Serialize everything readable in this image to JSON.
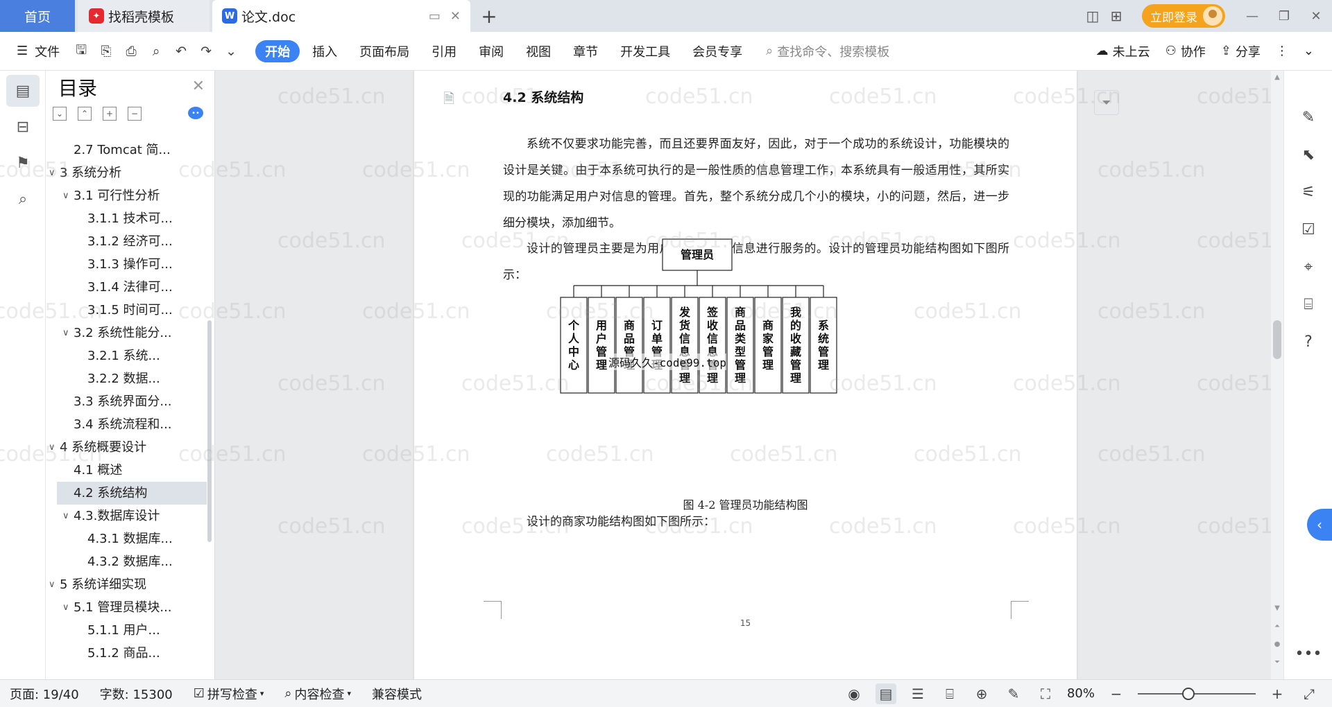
{
  "tabs": {
    "home": "首页",
    "templates": "找稻壳模板",
    "doc": "论文.doc"
  },
  "titlebar": {
    "login": "立即登录"
  },
  "ribbon": {
    "file_menu": "文件",
    "tabs": [
      "开始",
      "插入",
      "页面布局",
      "引用",
      "审阅",
      "视图",
      "章节",
      "开发工具",
      "会员专享"
    ],
    "active_tab": "开始",
    "search_placeholder": "查找命令、搜索模板",
    "cloud": "未上云",
    "collab": "协作",
    "share": "分享"
  },
  "outline": {
    "title": "目录",
    "items": [
      {
        "label": "2.7 Tomcat 简...",
        "level": 2,
        "arrow": ""
      },
      {
        "label": "3 系统分析",
        "level": 1,
        "arrow": "v"
      },
      {
        "label": "3.1 可行性分析",
        "level": 2,
        "arrow": "v"
      },
      {
        "label": "3.1.1 技术可...",
        "level": 3,
        "arrow": ""
      },
      {
        "label": "3.1.2 经济可...",
        "level": 3,
        "arrow": ""
      },
      {
        "label": "3.1.3 操作可...",
        "level": 3,
        "arrow": ""
      },
      {
        "label": "3.1.4 法律可...",
        "level": 3,
        "arrow": ""
      },
      {
        "label": "3.1.5 时间可...",
        "level": 3,
        "arrow": ""
      },
      {
        "label": "3.2 系统性能分...",
        "level": 2,
        "arrow": "v"
      },
      {
        "label": "3.2.1 系统...",
        "level": 3,
        "arrow": ""
      },
      {
        "label": "3.2.2 数据...",
        "level": 3,
        "arrow": ""
      },
      {
        "label": "3.3 系统界面分...",
        "level": 2,
        "arrow": ""
      },
      {
        "label": "3.4 系统流程和...",
        "level": 2,
        "arrow": ""
      },
      {
        "label": "4 系统概要设计",
        "level": 1,
        "arrow": "v"
      },
      {
        "label": "4.1 概述",
        "level": 2,
        "arrow": ""
      },
      {
        "label": "4.2 系统结构",
        "level": 2,
        "arrow": "",
        "selected": true
      },
      {
        "label": "4.3.数据库设计",
        "level": 2,
        "arrow": "v"
      },
      {
        "label": "4.3.1 数据库...",
        "level": 3,
        "arrow": ""
      },
      {
        "label": "4.3.2 数据库...",
        "level": 3,
        "arrow": ""
      },
      {
        "label": "5 系统详细实现",
        "level": 1,
        "arrow": "v"
      },
      {
        "label": "5.1 管理员模块...",
        "level": 2,
        "arrow": "v"
      },
      {
        "label": "5.1.1 用户...",
        "level": 3,
        "arrow": ""
      },
      {
        "label": "5.1.2 商品...",
        "level": 3,
        "arrow": ""
      }
    ]
  },
  "document": {
    "heading": "4.2 系统结构",
    "para1": "系统不仅要求功能完善，而且还要界面友好，因此，对于一个成功的系统设计，功能模块的设计是关键。由于本系统可执行的是一般性质的信息管理工作，本系统具有一般适用性，其所实现的功能满足用户对信息的管理。首先，整个系统分成几个小的模块，小的问题，然后，进一步细分模块，添加细节。",
    "para2": "设计的管理员主要是为用户提供的一些信息进行服务的。设计的管理员功能结构图如下图所示：",
    "diagram": {
      "root": "管理员",
      "children": [
        "个人中心",
        "用户管理",
        "商品管理",
        "订单管理",
        "发货信息管理",
        "签收信息管理",
        "商品类型管理",
        "商家管理",
        "我的收藏管理",
        "系统管理"
      ]
    },
    "overlay_text": "源码久久-code99.top",
    "caption": "图 4-2 管理员功能结构图",
    "para3": "设计的商家功能结构图如下图所示：",
    "page_number": "15"
  },
  "watermark": "code51.cn",
  "status": {
    "page": "页面: 19/40",
    "words": "字数: 15300",
    "spell": "拼写检查",
    "content_check": "内容检查",
    "compat": "兼容模式",
    "zoom": "80%",
    "zoom_level_percent": 80
  }
}
